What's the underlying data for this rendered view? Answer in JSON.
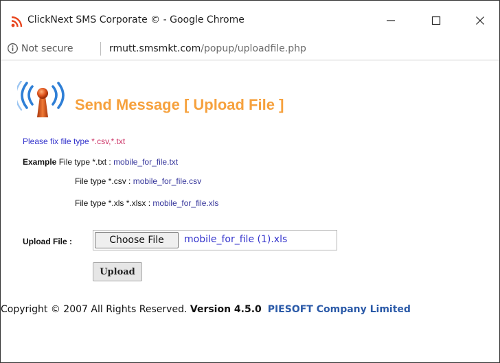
{
  "window": {
    "title": "ClickNext SMS Corporate © - Google Chrome",
    "icon": "rss-feed-icon",
    "controls": {
      "minimize_icon": "minimize-icon",
      "maximize_icon": "maximize-icon",
      "close_icon": "close-icon"
    }
  },
  "address_bar": {
    "security_icon": "info-circle-icon",
    "security_text": "Not secure",
    "url_host": "rmutt.smsmkt.com",
    "url_path": "/popup/uploadfile.php"
  },
  "page": {
    "logo_icon": "antenna-broadcast-icon",
    "heading": "Send Message [ Upload File ]",
    "note": {
      "text": "Please fix file type ",
      "types": "*.csv,*.txt"
    },
    "examples": {
      "label": "Example",
      "rows": [
        {
          "text": " File type *.txt : ",
          "file": "mobile_for_file.txt"
        },
        {
          "text": "File type *.csv : ",
          "file": "mobile_for_file.csv"
        },
        {
          "text": "File type *.xls *.xlsx : ",
          "file": "mobile_for_file.xls"
        }
      ]
    },
    "upload": {
      "label": "Upload File :",
      "choose_button": "Choose File",
      "selected_file": "mobile_for_file (1).xls",
      "submit_button": "Upload"
    },
    "footer": {
      "copyright": "Copyright © 2007 All Rights Reserved. ",
      "version": "Version 4.5.0",
      "company": "PIESOFT Company Limited"
    }
  },
  "colors": {
    "heading": "#f6a13d",
    "note": "#3333cc",
    "note_types": "#cc3366",
    "company": "#2b5aa8",
    "app_icon": "#e8451e"
  }
}
